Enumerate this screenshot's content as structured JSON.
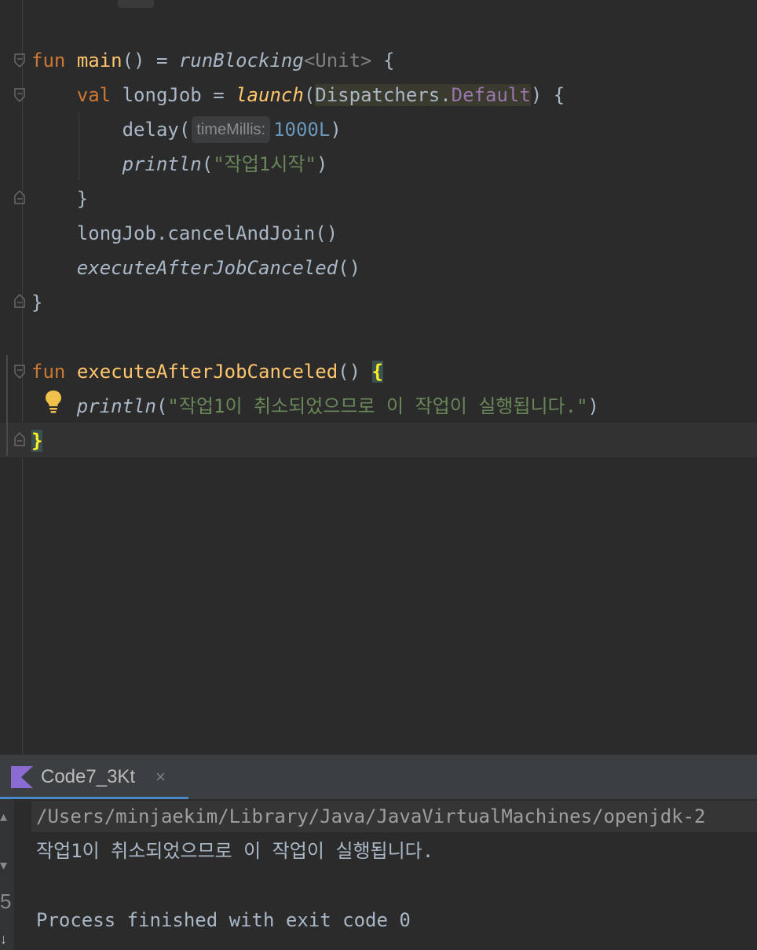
{
  "editor": {
    "lines": {
      "l1": {
        "kw": "fun",
        "name": "main",
        "rest1": "() = ",
        "call": "runBlocking",
        "gen": "<Unit>",
        "rest2": " {"
      },
      "l2": {
        "kw": "val",
        "mid": " longJob = ",
        "call": "launch",
        "p1": "(",
        "cls": "Dispatchers.",
        "prop": "Default",
        "p2": ") {"
      },
      "l3": {
        "call": "delay(",
        "hint": "timeMillis:",
        "num": "1000L",
        "end": ")"
      },
      "l4": {
        "call": "println",
        "p1": "(",
        "str": "\"작업1시작\"",
        "p2": ")"
      },
      "l5": {
        "text": "}"
      },
      "l6": {
        "text": "longJob.cancelAndJoin()"
      },
      "l7": {
        "call": "executeAfterJobCanceled",
        "p": "()"
      },
      "l8": {
        "text": "}"
      },
      "l9": {
        "kw": "fun",
        "name": "executeAfterJobCanceled",
        "rest": "() ",
        "brace": "{"
      },
      "l10": {
        "call": "println",
        "p1": "(",
        "str": "\"작업1이 취소되었으므로 이 작업이 실행됩니다.\"",
        "p2": ")"
      },
      "l11": {
        "brace": "}"
      }
    }
  },
  "run_panel": {
    "tab_label": "Code7_3Kt",
    "tab_close": "×",
    "console": {
      "command": "/Users/minjaekim/Library/Java/JavaVirtualMachines/openjdk-2",
      "output": "작업1이 취소되었으므로 이 작업이 실행됩니다.",
      "exit": "Process finished with exit code 0"
    },
    "gutter_mark": "5"
  },
  "colors": {
    "keyword": "#cc7832",
    "function": "#ffc66d",
    "string": "#6a8759",
    "number": "#6897bb",
    "property": "#9876aa",
    "accent": "#4a88c7"
  },
  "icons": {
    "fold": "fold-marker-icon",
    "bulb": "lightbulb-icon",
    "kotlin": "kotlin-icon",
    "close": "close-icon"
  }
}
